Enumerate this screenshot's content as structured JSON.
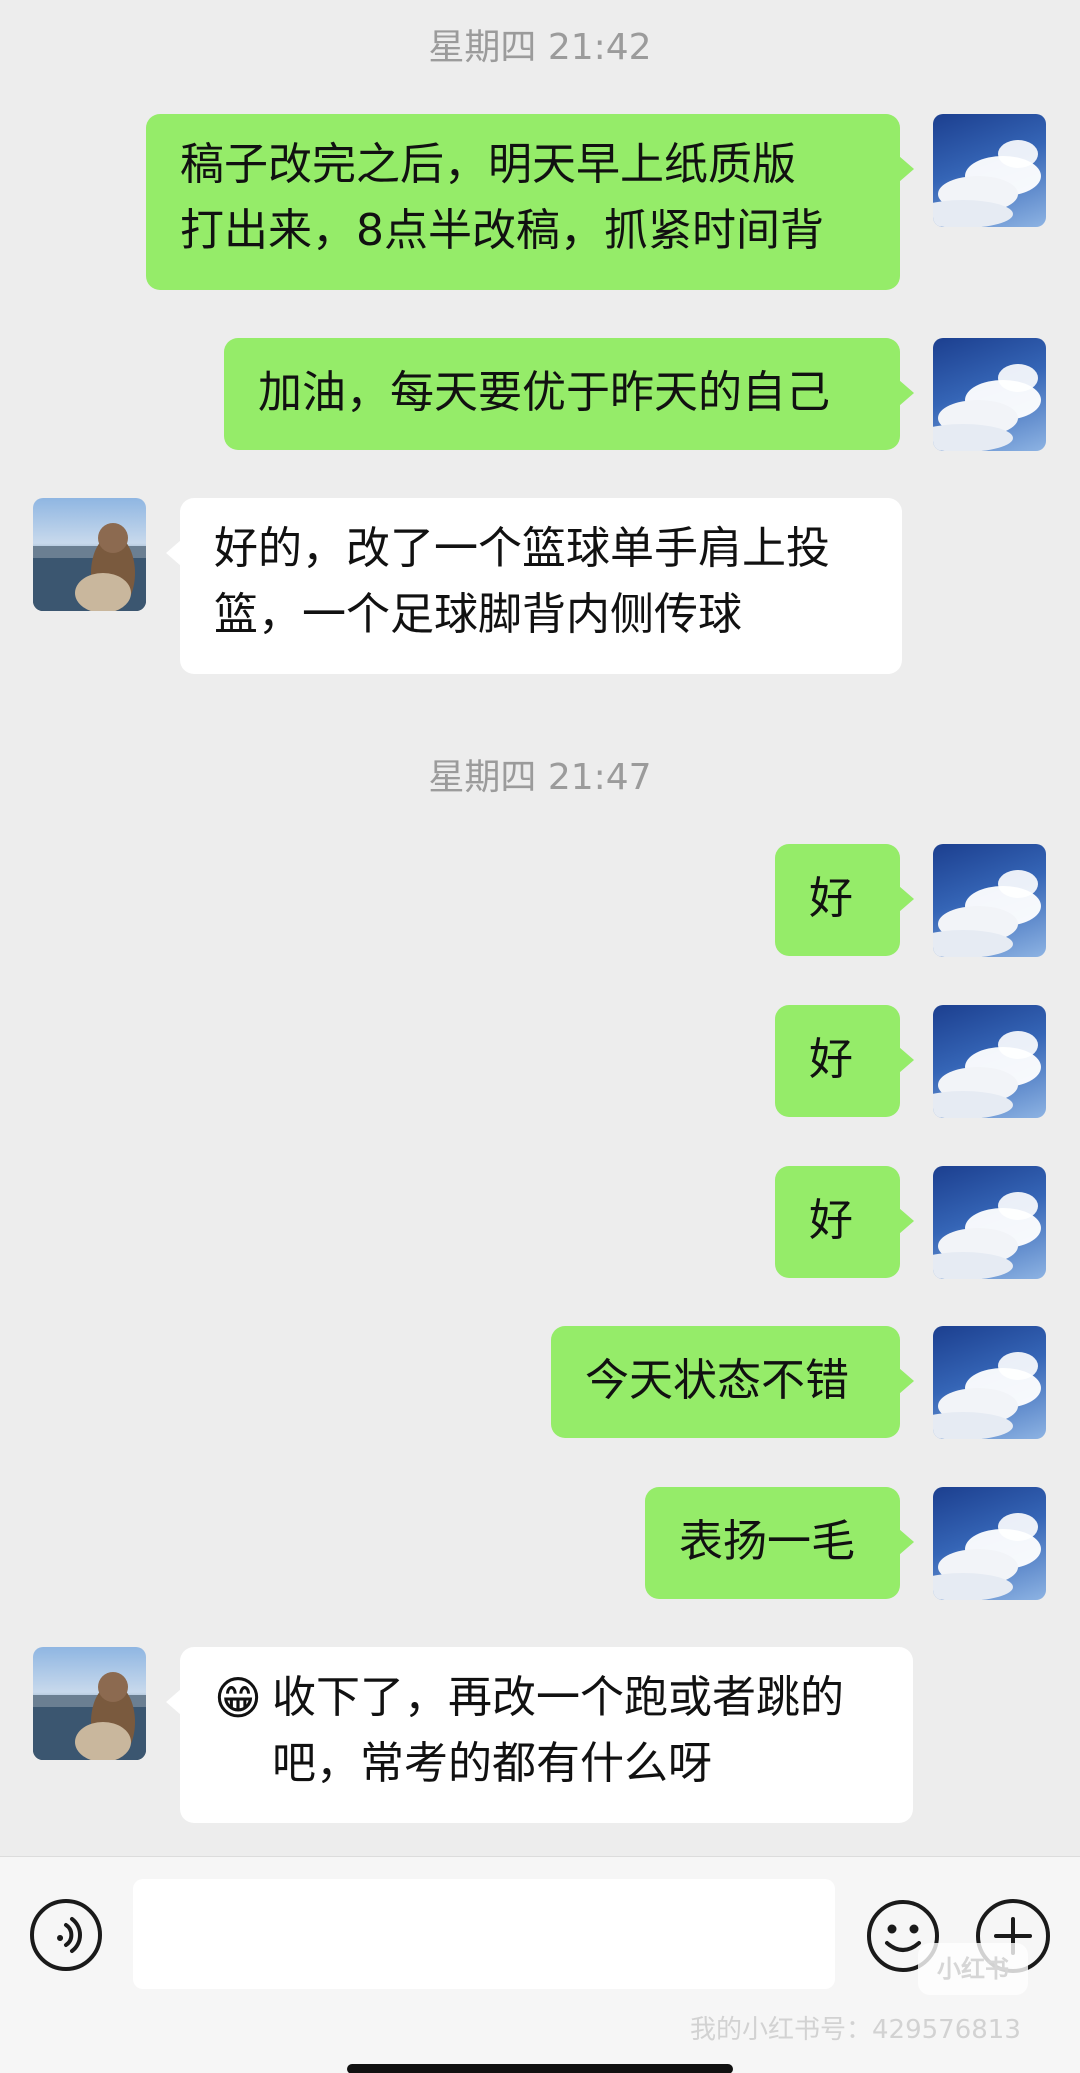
{
  "timestamps": [
    "星期四 21:42",
    "星期四 21:47"
  ],
  "messages": [
    {
      "sender": "me",
      "text": "稿子改完之后，明天早上纸质版\n打出来，8点半改稿，抓紧时间背"
    },
    {
      "sender": "me",
      "text": "加油，每天要优于昨天的自己"
    },
    {
      "sender": "other",
      "text": "好的，改了一个篮球单手肩上投\n篮，一个足球脚背内侧传球"
    },
    {
      "sender": "me",
      "text": "好"
    },
    {
      "sender": "me",
      "text": "好"
    },
    {
      "sender": "me",
      "text": "好"
    },
    {
      "sender": "me",
      "text": "今天状态不错"
    },
    {
      "sender": "me",
      "text": "表扬一毛"
    },
    {
      "sender": "other",
      "emoji": "😁",
      "text": "收下了，再改一个跑或者跳的\n吧，常考的都有什么呀"
    }
  ],
  "input": {
    "placeholder": "",
    "value": ""
  },
  "icons": {
    "voice": "voice-icon",
    "emoji": "smiley-emoji-icon",
    "more": "plus-icon"
  },
  "watermark": {
    "logo": "小红书",
    "id_text": "我的小红书号：429576813"
  },
  "colors": {
    "me_bubble": "#95ec69",
    "other_bubble": "#ffffff",
    "background": "#ededed"
  }
}
